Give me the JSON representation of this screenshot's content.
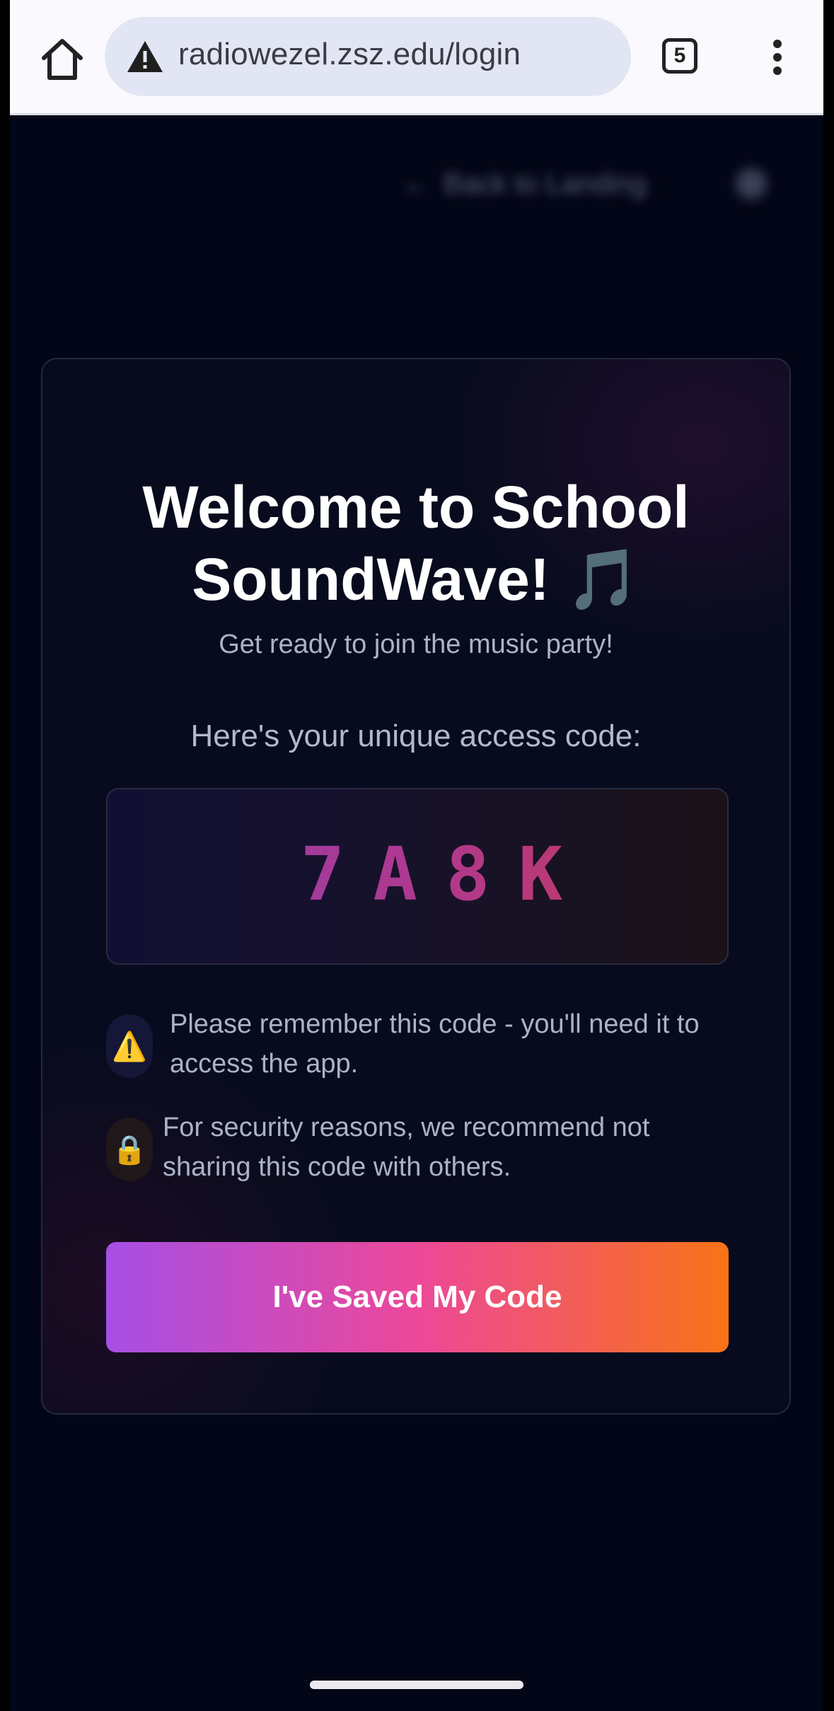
{
  "browser": {
    "url": "radiowezel.zsz.edu/login",
    "tab_count": "5",
    "icons": {
      "home": "home-icon",
      "security": "not-secure-warning-icon",
      "menu": "more-vert-icon"
    }
  },
  "nav": {
    "back_label": "Back to Landing",
    "back_arrow": "←"
  },
  "card": {
    "title_line1": "Welcome to School",
    "title_line2": "SoundWave!",
    "title_emoji": "🎵",
    "subtitle": "Get ready to join the music party!",
    "code_label": "Here's your unique access code:",
    "access_code": "7A8K",
    "notices": [
      {
        "icon": "⚠️",
        "icon_name": "warning-icon",
        "text": "Please remember this code - you'll need it to access the app."
      },
      {
        "icon": "🔒",
        "icon_name": "lock-icon",
        "text": "For security reasons, we recommend not sharing this code with others."
      }
    ],
    "button_label": "I've Saved My Code"
  },
  "colors": {
    "background": "#030616",
    "card_background": "#070b1d",
    "button_gradient": [
      "#a64fe6",
      "#ec4899",
      "#f97316"
    ],
    "code_gradient": [
      "#8e3bae",
      "#b0398e",
      "#c73a4e"
    ]
  }
}
